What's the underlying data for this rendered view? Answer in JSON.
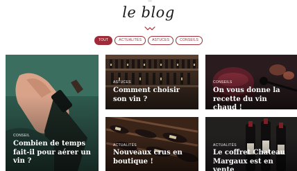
{
  "blog": {
    "title": "le blog"
  },
  "filters": [
    {
      "label": "TOUT",
      "active": true
    },
    {
      "label": "ACTUALITÉS",
      "active": false
    },
    {
      "label": "ASTUCES",
      "active": false
    },
    {
      "label": "CONSEILS",
      "active": false
    }
  ],
  "articles": [
    {
      "category": "CONSEIL",
      "title": "Combien de temps fait-il pour aérer un vin ?"
    },
    {
      "category": "ASTUCES",
      "title": "Comment choisir son vin ?"
    },
    {
      "category": "CONSEILS",
      "title": "On vous donne la recette du vin chaud !"
    },
    {
      "category": "ACTUALITÉS",
      "title": "Nouveaux crus en boutique !"
    },
    {
      "category": "ACTUALITÉS",
      "title": "Le coffret Chateau Margaux est en vente"
    }
  ],
  "colors": {
    "accent": "#9e2b37",
    "text": "#1b1b1b"
  }
}
